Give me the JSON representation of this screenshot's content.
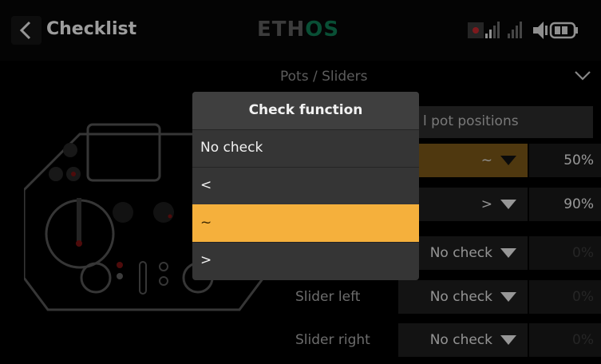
{
  "header": {
    "title": "Checklist",
    "logo_left": "ETH",
    "logo_right": "OS"
  },
  "section": {
    "title": "Pots / Sliders"
  },
  "description": "l pot positions",
  "rows": [
    {
      "label": "",
      "check": "~",
      "value": "50%"
    },
    {
      "label": "",
      "check": ">",
      "value": "90%"
    },
    {
      "label": "",
      "check": "No check",
      "value": "0%"
    },
    {
      "label": "Slider left",
      "check": "No check",
      "value": "0%"
    },
    {
      "label": "Slider right",
      "check": "No check",
      "value": "0%"
    }
  ],
  "popup": {
    "title": "Check function",
    "options": [
      "No check",
      "<",
      "~",
      ">"
    ],
    "selected": "~"
  },
  "colors": {
    "accent": "#f5b03c",
    "active_row": "#7a5718",
    "logo_green": "#0e7a52"
  }
}
